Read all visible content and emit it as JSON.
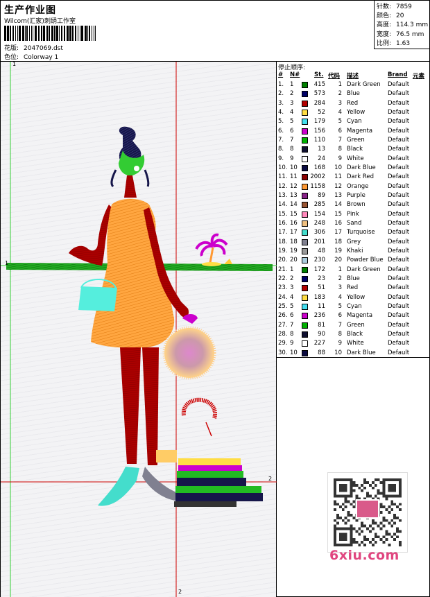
{
  "header": {
    "title": "生产作业图",
    "studio": "Wilcom(汇家)刺绣工作室",
    "design_label": "花版:",
    "design_value": "2047069.dst",
    "colorway_label": "色位:",
    "colorway_value": "Colorway 1"
  },
  "stats": [
    {
      "label": "针数:",
      "value": "7859"
    },
    {
      "label": "颜色:",
      "value": "20"
    },
    {
      "label": "高度:",
      "value": "114.3 mm"
    },
    {
      "label": "宽度:",
      "value": "76.5 mm"
    },
    {
      "label": "比例:",
      "value": "1.63"
    }
  ],
  "canvas": {
    "marker_v_top": "1",
    "marker_h_left": "1",
    "marker_v_bottom": "2",
    "marker_h_right": "2"
  },
  "sequence": {
    "title": "停止顺序:",
    "headers": {
      "idx": "#",
      "n": "N#",
      "st": "St.",
      "code": "代码",
      "desc": "描述",
      "brand": "Brand",
      "elem": "元素"
    },
    "rows": [
      {
        "idx": "1.",
        "n": "1",
        "color": "#008000",
        "st": "415",
        "code": "1",
        "desc": "Dark Green",
        "brand": "Default"
      },
      {
        "idx": "2.",
        "n": "2",
        "color": "#000066",
        "st": "573",
        "code": "2",
        "desc": "Blue",
        "brand": "Default"
      },
      {
        "idx": "3.",
        "n": "3",
        "color": "#b00000",
        "st": "284",
        "code": "3",
        "desc": "Red",
        "brand": "Default"
      },
      {
        "idx": "4.",
        "n": "4",
        "color": "#ffdd44",
        "st": "52",
        "code": "4",
        "desc": "Yellow",
        "brand": "Default"
      },
      {
        "idx": "5.",
        "n": "5",
        "color": "#44ddee",
        "st": "179",
        "code": "5",
        "desc": "Cyan",
        "brand": "Default"
      },
      {
        "idx": "6.",
        "n": "6",
        "color": "#cc00cc",
        "st": "156",
        "code": "6",
        "desc": "Magenta",
        "brand": "Default"
      },
      {
        "idx": "7.",
        "n": "7",
        "color": "#00b000",
        "st": "110",
        "code": "7",
        "desc": "Green",
        "brand": "Default"
      },
      {
        "idx": "8.",
        "n": "8",
        "color": "#101030",
        "st": "13",
        "code": "8",
        "desc": "Black",
        "brand": "Default"
      },
      {
        "idx": "9.",
        "n": "9",
        "color": "#ffffff",
        "st": "24",
        "code": "9",
        "desc": "White",
        "brand": "Default"
      },
      {
        "idx": "10.",
        "n": "10",
        "color": "#0a0a40",
        "st": "168",
        "code": "10",
        "desc": "Dark Blue",
        "brand": "Default"
      },
      {
        "idx": "11.",
        "n": "11",
        "color": "#8b0000",
        "st": "2002",
        "code": "11",
        "desc": "Dark Red",
        "brand": "Default"
      },
      {
        "idx": "12.",
        "n": "12",
        "color": "#ff9933",
        "st": "1158",
        "code": "12",
        "desc": "Orange",
        "brand": "Default"
      },
      {
        "idx": "13.",
        "n": "13",
        "color": "#882288",
        "st": "89",
        "code": "13",
        "desc": "Purple",
        "brand": "Default"
      },
      {
        "idx": "14.",
        "n": "14",
        "color": "#995533",
        "st": "285",
        "code": "14",
        "desc": "Brown",
        "brand": "Default"
      },
      {
        "idx": "15.",
        "n": "15",
        "color": "#ff88bb",
        "st": "154",
        "code": "15",
        "desc": "Pink",
        "brand": "Default"
      },
      {
        "idx": "16.",
        "n": "16",
        "color": "#f0c080",
        "st": "248",
        "code": "16",
        "desc": "Sand",
        "brand": "Default"
      },
      {
        "idx": "17.",
        "n": "17",
        "color": "#44ddcc",
        "st": "306",
        "code": "17",
        "desc": "Turquoise",
        "brand": "Default"
      },
      {
        "idx": "18.",
        "n": "18",
        "color": "#808090",
        "st": "201",
        "code": "18",
        "desc": "Grey",
        "brand": "Default"
      },
      {
        "idx": "19.",
        "n": "19",
        "color": "#999999",
        "st": "48",
        "code": "19",
        "desc": "Khaki",
        "brand": "Default"
      },
      {
        "idx": "20.",
        "n": "20",
        "color": "#aaccdd",
        "st": "230",
        "code": "20",
        "desc": "Powder Blue",
        "brand": "Default"
      },
      {
        "idx": "21.",
        "n": "1",
        "color": "#008000",
        "st": "172",
        "code": "1",
        "desc": "Dark Green",
        "brand": "Default"
      },
      {
        "idx": "22.",
        "n": "2",
        "color": "#000066",
        "st": "23",
        "code": "2",
        "desc": "Blue",
        "brand": "Default"
      },
      {
        "idx": "23.",
        "n": "3",
        "color": "#b00000",
        "st": "51",
        "code": "3",
        "desc": "Red",
        "brand": "Default"
      },
      {
        "idx": "24.",
        "n": "4",
        "color": "#ffdd44",
        "st": "183",
        "code": "4",
        "desc": "Yellow",
        "brand": "Default"
      },
      {
        "idx": "25.",
        "n": "5",
        "color": "#44ddee",
        "st": "11",
        "code": "5",
        "desc": "Cyan",
        "brand": "Default"
      },
      {
        "idx": "26.",
        "n": "6",
        "color": "#cc00cc",
        "st": "236",
        "code": "6",
        "desc": "Magenta",
        "brand": "Default"
      },
      {
        "idx": "27.",
        "n": "7",
        "color": "#00b000",
        "st": "81",
        "code": "7",
        "desc": "Green",
        "brand": "Default"
      },
      {
        "idx": "28.",
        "n": "8",
        "color": "#101030",
        "st": "90",
        "code": "8",
        "desc": "Black",
        "brand": "Default"
      },
      {
        "idx": "29.",
        "n": "9",
        "color": "#ffffff",
        "st": "227",
        "code": "9",
        "desc": "White",
        "brand": "Default"
      },
      {
        "idx": "30.",
        "n": "10",
        "color": "#0a0a40",
        "st": "88",
        "code": "10",
        "desc": "Dark Blue",
        "brand": "Default"
      }
    ]
  },
  "watermark": {
    "text": "6xiu.com",
    "color": "#e0457f"
  }
}
